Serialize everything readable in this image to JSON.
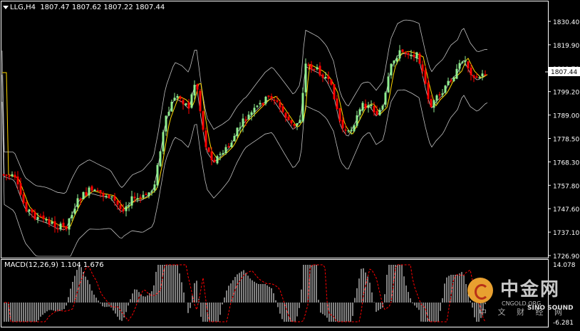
{
  "header": {
    "symbol": "LLG,H4",
    "ohlc": "1807.47 1807.62 1807.22 1807.44"
  },
  "macd": {
    "label": "MACD(12,26,9) 1.104 1.676",
    "axis_top": "14.078",
    "axis_bottom": "-6.281"
  },
  "price_axis": {
    "labels": [
      "1830.40",
      "1819.90",
      "1809.70",
      "1799.20",
      "1789.00",
      "1778.50",
      "1768.30",
      "1757.80",
      "1747.60",
      "1737.10",
      "1726.90"
    ],
    "current_price": "1807.44"
  },
  "watermark": {
    "brand": "中金网",
    "site": "CNGOLD.ORG",
    "sub": "中 文 财 经 网",
    "sound": "SINO SOUND"
  },
  "colors": {
    "background": "#000000",
    "bull": "#90ee90",
    "bear": "#ff0000",
    "bands": "#c0c0c0",
    "ma": "#ffd700",
    "macd_hist": "#ffffff",
    "macd_signal": "#ff0000"
  }
}
